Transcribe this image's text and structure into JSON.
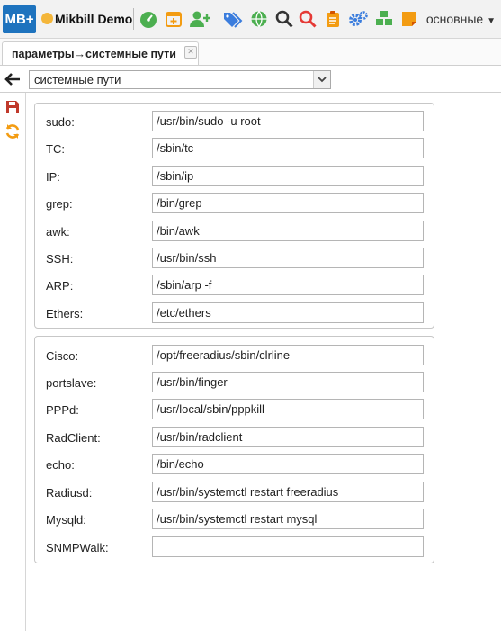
{
  "header": {
    "logo": "MB+",
    "brand": "Mikbill Demo",
    "menu_label": "основные",
    "icons": [
      "dashboard-icon",
      "calendar-icon",
      "add-user-icon",
      "tags-icon",
      "globe-icon",
      "search-icon",
      "search-red-icon",
      "clipboard-icon",
      "cogs-icon",
      "cubes-icon",
      "note-icon"
    ]
  },
  "tabs": [
    {
      "label": "параметры→системные пути"
    }
  ],
  "nav": {
    "selected": "системные пути"
  },
  "groups": [
    {
      "rows": [
        {
          "label": "sudo:",
          "value": "/usr/bin/sudo -u root"
        },
        {
          "label": "TC:",
          "value": "/sbin/tc"
        },
        {
          "label": "IP:",
          "value": "/sbin/ip"
        },
        {
          "label": "grep:",
          "value": "/bin/grep"
        },
        {
          "label": "awk:",
          "value": "/bin/awk"
        },
        {
          "label": "SSH:",
          "value": "/usr/bin/ssh"
        },
        {
          "label": "ARP:",
          "value": "/sbin/arp -f"
        },
        {
          "label": "Ethers:",
          "value": "/etc/ethers"
        }
      ]
    },
    {
      "rows": [
        {
          "label": "Cisco:",
          "value": "/opt/freeradius/sbin/clrline"
        },
        {
          "label": "portslave:",
          "value": "/usr/bin/finger"
        },
        {
          "label": "PPPd:",
          "value": "/usr/local/sbin/pppkill"
        },
        {
          "label": "RadClient:",
          "value": "/usr/bin/radclient"
        },
        {
          "label": "echo:",
          "value": "/bin/echo"
        },
        {
          "label": "Radiusd:",
          "value": "/usr/bin/systemctl restart freeradius"
        },
        {
          "label": "Mysqld:",
          "value": "/usr/bin/systemctl restart mysql"
        },
        {
          "label": "SNMPWalk:",
          "value": ""
        }
      ]
    }
  ]
}
